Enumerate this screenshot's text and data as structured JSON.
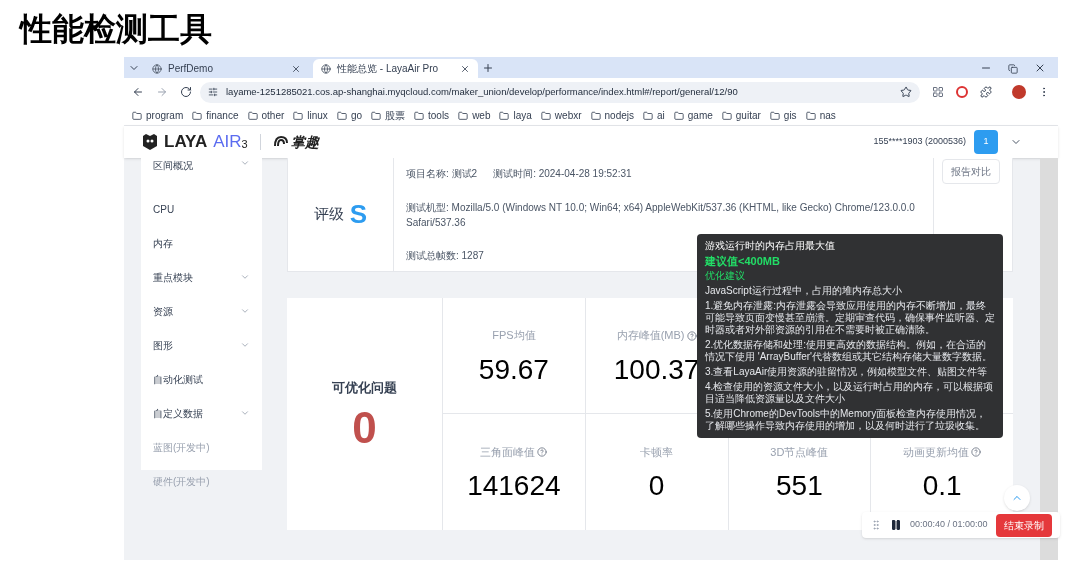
{
  "slide_title": "性能检测工具",
  "browser": {
    "tabs": [
      {
        "title": "PerfDemo",
        "selected": false
      },
      {
        "title": "性能总览 - LayaAir Pro",
        "selected": true
      }
    ],
    "url": "layame-1251285021.cos.ap-shanghai.myqcloud.com/maker_union/develop/performance/index.html#/report/general/12/90",
    "bookmarks": [
      "program",
      "finance",
      "other",
      "linux",
      "go",
      "股票",
      "tools",
      "web",
      "laya",
      "webxr",
      "nodejs",
      "ai",
      "game",
      "guitar",
      "gis",
      "nas"
    ]
  },
  "header": {
    "logo_main": "LAYA",
    "logo_air": "AIR",
    "logo_version": "3",
    "partner": "掌趣",
    "user": "155****1903 (2000536)",
    "badge": "1"
  },
  "sidebar": {
    "items": [
      {
        "label": "区间概况",
        "expandable": true,
        "disabled": false
      },
      {
        "label": "CPU",
        "expandable": false,
        "disabled": false
      },
      {
        "label": "内存",
        "expandable": false,
        "disabled": false
      },
      {
        "label": "重点模块",
        "expandable": true,
        "disabled": false
      },
      {
        "label": "资源",
        "expandable": true,
        "disabled": false
      },
      {
        "label": "图形",
        "expandable": true,
        "disabled": false
      },
      {
        "label": "自动化测试",
        "expandable": false,
        "disabled": false
      },
      {
        "label": "自定义数据",
        "expandable": true,
        "disabled": false
      },
      {
        "label": "蓝图(开发中)",
        "expandable": false,
        "disabled": true
      },
      {
        "label": "硬件(开发中)",
        "expandable": false,
        "disabled": true
      }
    ]
  },
  "report": {
    "grade_label": "评级",
    "grade": "S",
    "project": "项目名称: 测试2",
    "time": "测试时间: 2024-04-28 19:52:31",
    "device": "测试机型: Mozilla/5.0 (Windows NT 10.0; Win64; x64) AppleWebKit/537.36 (KHTML, like Gecko) Chrome/123.0.0.0 Safari/537.36",
    "frames": "测试总帧数: 1287",
    "compare_button": "报告对比"
  },
  "stats": {
    "summary_label": "可优化问题",
    "summary_value": "0",
    "top_metrics": [
      {
        "label": "FPS均值",
        "value": "59.67",
        "help": false
      },
      {
        "label": "内存峰值(MB)",
        "value": "100.37",
        "help": true
      }
    ],
    "bottom_metrics": [
      {
        "label": "三角面峰值",
        "value": "141624",
        "help": true
      },
      {
        "label": "卡顿率",
        "value": "0",
        "help": false
      },
      {
        "label": "3D节点峰值",
        "value": "551",
        "help": false
      },
      {
        "label": "动画更新均值",
        "value": "0.1",
        "help": true
      }
    ]
  },
  "tooltip": {
    "title": "游戏运行时的内存占用最大值",
    "recommend": "建议值<400MB",
    "heading": "优化建议",
    "lines": [
      "JavaScript运行过程中，占用的堆内存总大小",
      "1.避免内存泄露:内存泄露会导致应用使用的内存不断增加，最终可能导致页面变慢甚至崩溃。定期审查代码，确保事件监听器、定时器或者对外部资源的引用在不需要时被正确清除。",
      "2.优化数据存储和处理:使用更高效的数据结构。例如，在合适的情况下使用 'ArrayBuffer'代替数组或其它结构存储大量数字数据。",
      "3.查看LayaAir使用资源的驻留情况，例如模型文件、贴图文件等",
      "4.检查使用的资源文件大小，以及运行时占用的内存，可以根据项目适当降低资源量以及文件大小",
      "5.使用Chrome的DevTools中的Memory面板检查内存使用情况，了解哪些操作导致内存使用的增加，以及何时进行了垃圾收集。"
    ]
  },
  "recorder": {
    "time": "00:00:40 / 01:00:00",
    "stop_button": "结束录制"
  }
}
